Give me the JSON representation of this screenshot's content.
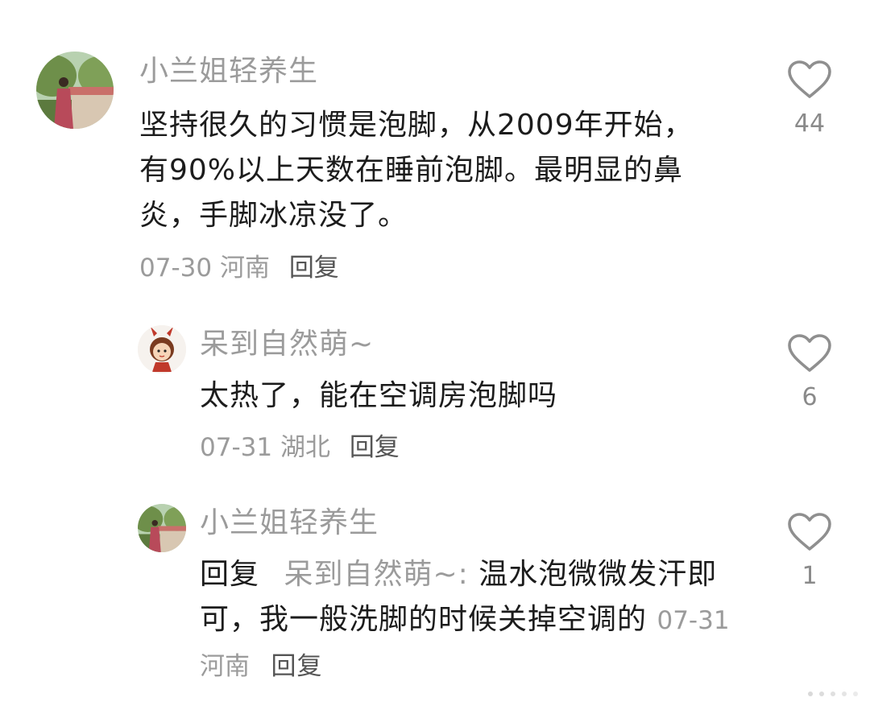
{
  "comments": [
    {
      "username": "小兰姐轻养生",
      "text": "坚持很久的习惯是泡脚，从2009年开始，有90%以上天数在睡前泡脚。最明显的鼻炎，手脚冰凉没了。",
      "date": "07-30",
      "location": "河南",
      "reply_label": "回复",
      "likes": "44"
    },
    {
      "username": "呆到自然萌~",
      "text": "太热了，能在空调房泡脚吗",
      "date": "07-31",
      "location": "湖北",
      "reply_label": "回复",
      "likes": "6"
    },
    {
      "username": "小兰姐轻养生",
      "reply_prefix": "回复",
      "reply_to": "呆到自然萌~:",
      "text": "温水泡微微发汗即可，我一般洗脚的时候关掉空调的",
      "date": "07-31",
      "location": "河南",
      "reply_label": "回复",
      "likes": "1"
    }
  ],
  "icons": {
    "like": "heart-outline-icon"
  },
  "colors": {
    "text": "#1c1c1c",
    "secondary": "#9b9b9b",
    "background": "#ffffff"
  }
}
